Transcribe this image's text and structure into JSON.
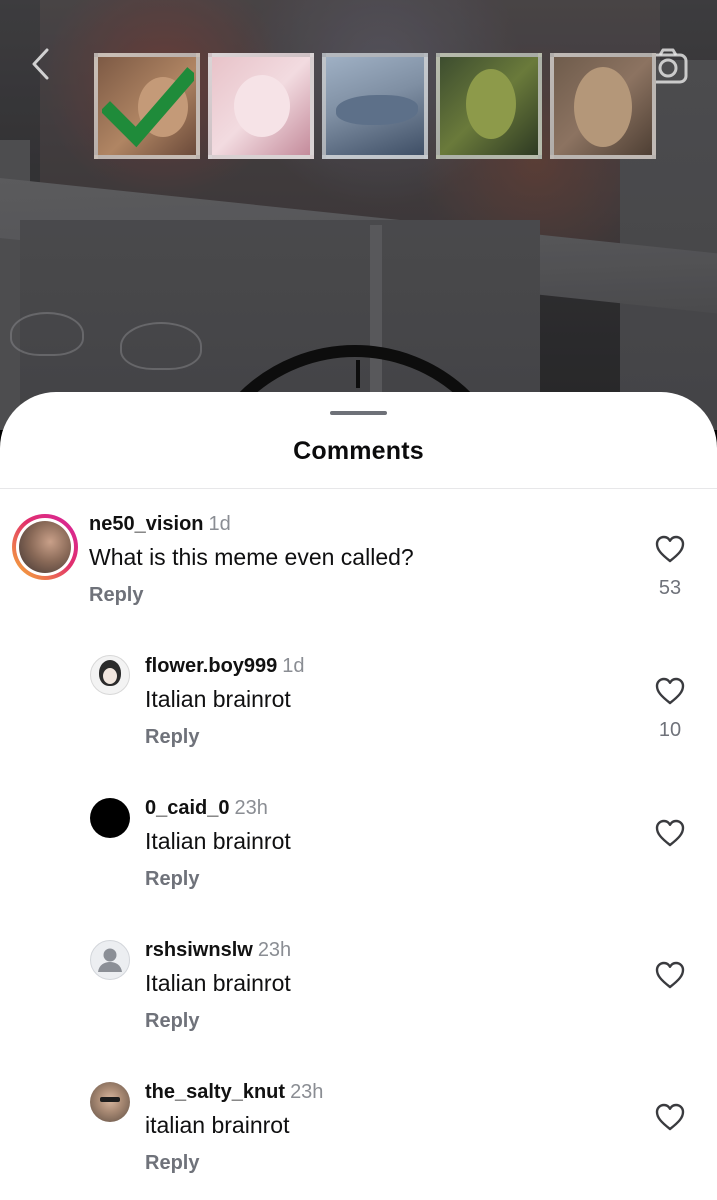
{
  "header": {
    "back_icon": "chevron-left-icon",
    "camera_icon": "camera-icon"
  },
  "video": {
    "thumbnails": [
      {
        "name": "meme-thumbnail-1",
        "checked": true
      },
      {
        "name": "meme-thumbnail-2",
        "checked": false
      },
      {
        "name": "meme-thumbnail-3",
        "checked": false
      },
      {
        "name": "meme-thumbnail-4",
        "checked": false
      },
      {
        "name": "meme-thumbnail-5",
        "checked": false
      }
    ]
  },
  "sheet": {
    "title": "Comments"
  },
  "comments": [
    {
      "username": "ne50_vision",
      "time": "1d",
      "text": "What is this meme even called?",
      "reply_label": "Reply",
      "likes": "53"
    },
    {
      "username": "flower.boy999",
      "time": "1d",
      "text": "Italian brainrot",
      "reply_label": "Reply",
      "likes": "10"
    },
    {
      "username": "0_caid_0",
      "time": "23h",
      "text": "Italian brainrot",
      "reply_label": "Reply",
      "likes": ""
    },
    {
      "username": "rshsiwnslw",
      "time": "23h",
      "text": "Italian brainrot",
      "reply_label": "Reply",
      "likes": ""
    },
    {
      "username": "the_salty_knut",
      "time": "23h",
      "text": "italian brainrot",
      "reply_label": "Reply",
      "likes": ""
    }
  ],
  "colors": {
    "story_ring_start": "#f7b733",
    "story_ring_end": "#d6249f",
    "check_green": "#1f8b3a",
    "secondary_text": "#6f727a"
  }
}
